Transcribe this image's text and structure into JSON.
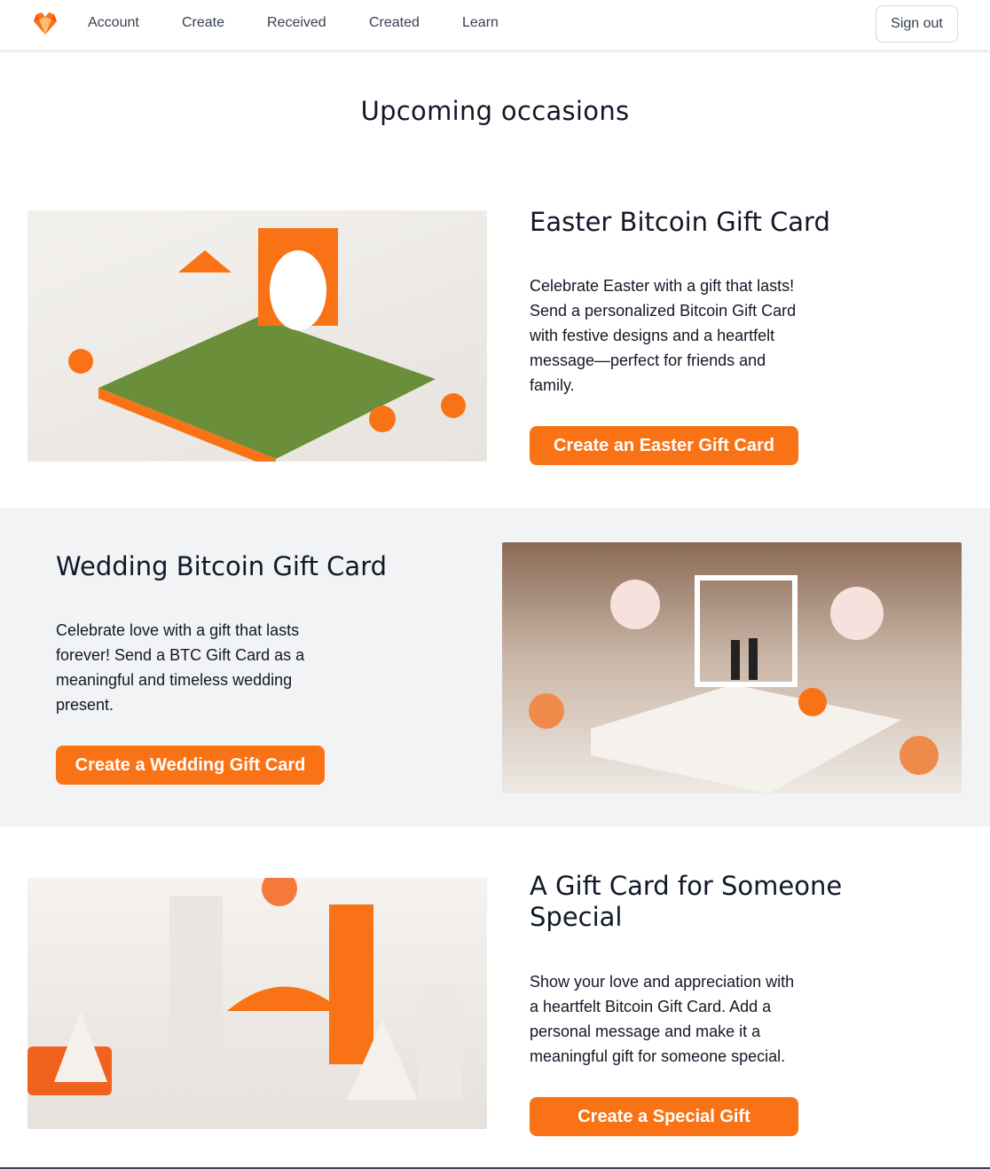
{
  "nav": {
    "logo": "heart-gem-logo",
    "links": [
      "Account",
      "Create",
      "Received",
      "Created",
      "Learn"
    ],
    "sign_out": "Sign out"
  },
  "page_title": "Upcoming occasions",
  "cards": [
    {
      "title": "Easter Bitcoin Gift Card",
      "description": "Celebrate Easter with a gift that lasts! Send a personalized Bitcoin Gift Card with festive designs and a heartfelt message—perfect for friends and family.",
      "button": "Create an Easter Gift Card"
    },
    {
      "title": "Wedding Bitcoin Gift Card",
      "description": "Celebrate love with a gift that lasts forever! Send a BTC Gift Card as a meaningful and timeless wedding present.",
      "button": "Create a Wedding Gift Card"
    },
    {
      "title": "A Gift Card for Someone Special",
      "description": "Show your love and appreciation with a heartfelt Bitcoin Gift Card. Add a personal message and make it a meaningful gift for someone special.",
      "button": "Create a Special Gift"
    }
  ],
  "colors": {
    "accent": "#f97316",
    "section_alt": "#f2f3f5"
  }
}
